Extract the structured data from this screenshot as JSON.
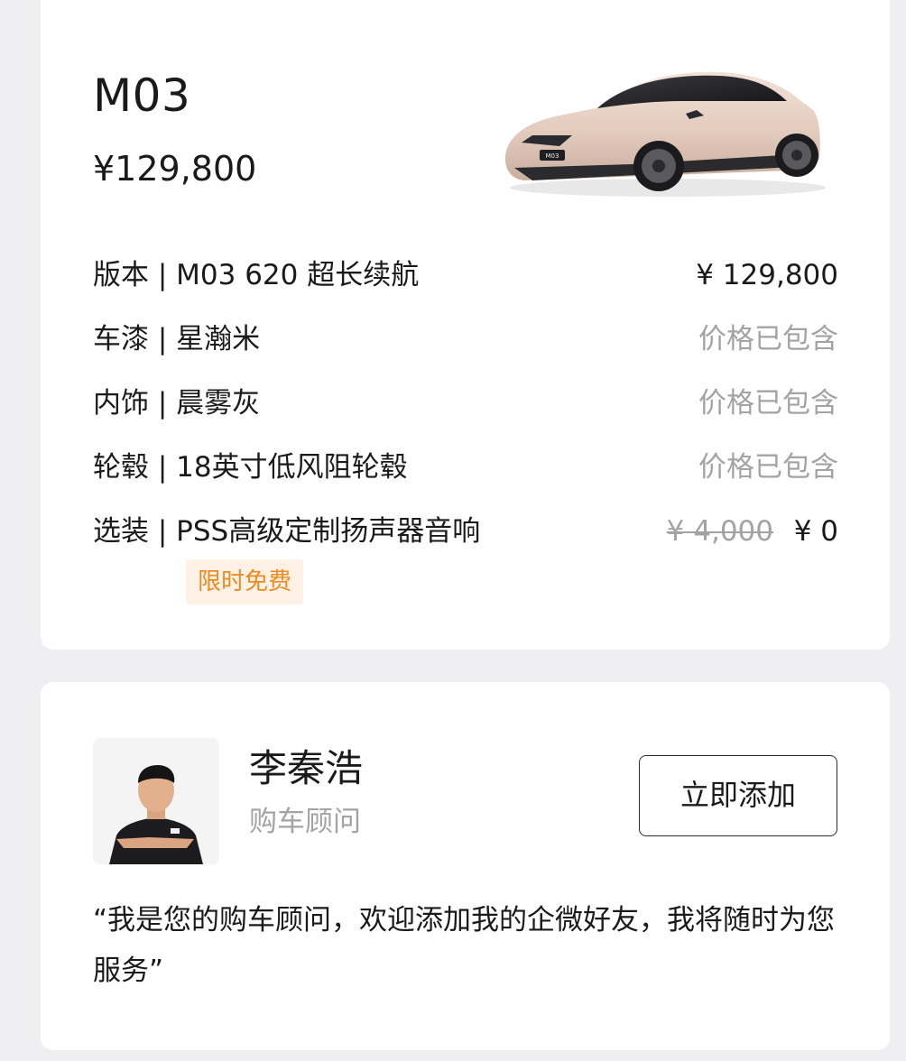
{
  "car": {
    "model": "M03",
    "price": "¥129,800",
    "specs": [
      {
        "label": "版本 | M03 620 超长续航",
        "value": "¥ 129,800"
      },
      {
        "label": "车漆 | 星瀚米",
        "value": "价格已包含"
      },
      {
        "label": "内饰 | 晨雾灰",
        "value": "价格已包含"
      },
      {
        "label": "轮毂 | 18英寸低风阻轮毂",
        "value": "价格已包含"
      },
      {
        "label": "选装 | PSS高级定制扬声器音响",
        "old_price": "¥ 4,000",
        "value": "¥ 0"
      }
    ],
    "promo_tag": "限时免费",
    "image_alt_text": "M03"
  },
  "advisor": {
    "name": "李秦浩",
    "role": "购车顾问",
    "add_button": "立即添加",
    "quote": "“我是您的购车顾问，欢迎添加我的企微好友，我将随时为您服务”"
  }
}
